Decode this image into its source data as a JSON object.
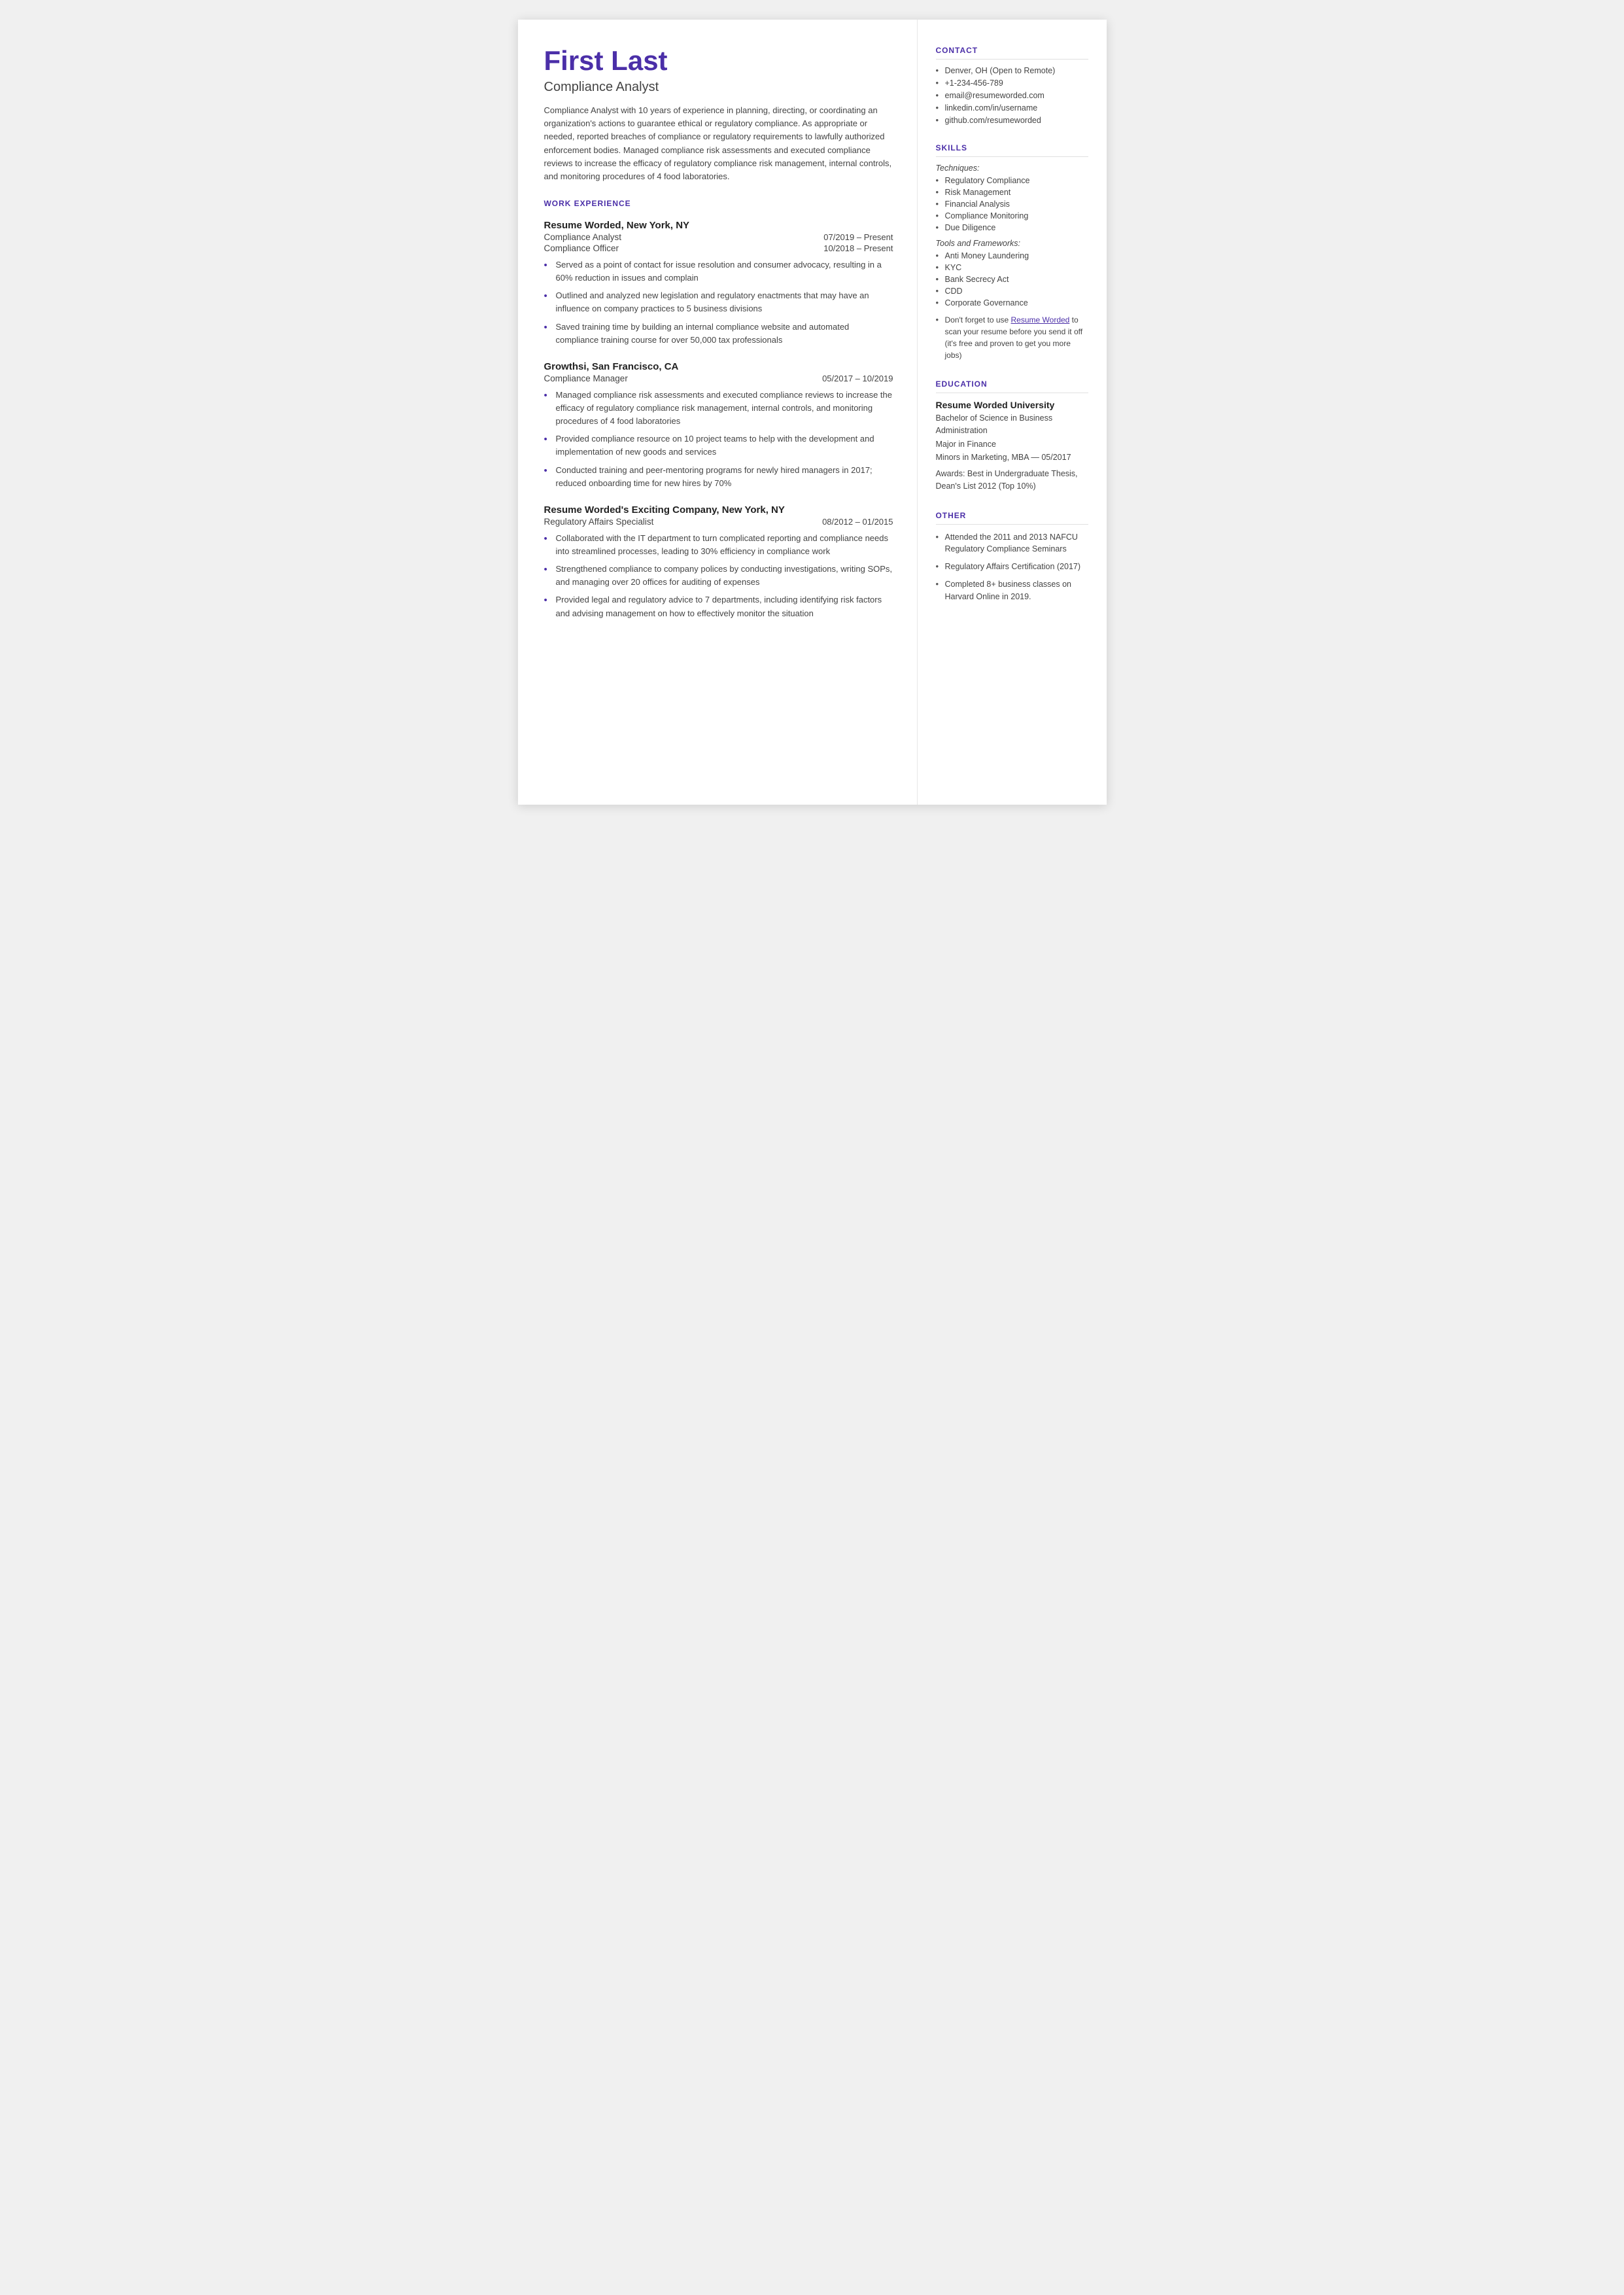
{
  "header": {
    "name": "First Last",
    "title": "Compliance Analyst",
    "summary": "Compliance Analyst with 10 years of experience in planning, directing, or coordinating an organization's actions to guarantee ethical or regulatory compliance. As appropriate or needed, reported breaches of compliance or regulatory requirements to lawfully authorized enforcement bodies. Managed compliance risk assessments and executed compliance reviews to increase the efficacy of regulatory compliance risk management, internal controls, and monitoring procedures of 4 food laboratories."
  },
  "work_experience": {
    "section_label": "WORK EXPERIENCE",
    "employers": [
      {
        "name": "Resume Worded, New York, NY",
        "roles": [
          {
            "title": "Compliance Analyst",
            "dates": "07/2019 – Present"
          },
          {
            "title": "Compliance Officer",
            "dates": "10/2018 – Present"
          }
        ],
        "bullets": [
          "Served as a point of contact for issue resolution and consumer advocacy, resulting in a 60% reduction in issues and complain",
          "Outlined and analyzed new legislation and regulatory enactments that may have an influence on company practices to 5 business divisions",
          "Saved training time by building an internal compliance website and automated compliance training course for over 50,000 tax professionals"
        ]
      },
      {
        "name": "Growthsi, San Francisco, CA",
        "roles": [
          {
            "title": "Compliance Manager",
            "dates": "05/2017 – 10/2019"
          }
        ],
        "bullets": [
          "Managed compliance risk assessments and executed compliance reviews to increase the efficacy of regulatory compliance risk management, internal controls, and monitoring procedures of 4 food laboratories",
          "Provided compliance resource on 10 project teams to help with the development and implementation of new goods and services",
          "Conducted training and peer-mentoring programs for newly hired managers in 2017; reduced onboarding time for new hires by 70%"
        ]
      },
      {
        "name": "Resume Worded's Exciting Company, New York, NY",
        "roles": [
          {
            "title": "Regulatory Affairs Specialist",
            "dates": "08/2012 – 01/2015"
          }
        ],
        "bullets": [
          "Collaborated with the IT department to turn complicated reporting and compliance needs into streamlined processes, leading to 30% efficiency in compliance work",
          "Strengthened compliance to company polices by conducting investigations, writing SOPs, and managing over 20 offices for auditing of expenses",
          "Provided legal and regulatory advice to 7 departments, including identifying risk factors and advising management on how to effectively monitor the situation"
        ]
      }
    ]
  },
  "contact": {
    "section_label": "CONTACT",
    "items": [
      "Denver, OH (Open to Remote)",
      "+1-234-456-789",
      "email@resumeworded.com",
      "linkedin.com/in/username",
      "github.com/resumeworded"
    ]
  },
  "skills": {
    "section_label": "SKILLS",
    "techniques_label": "Techniques:",
    "techniques": [
      "Regulatory Compliance",
      "Risk Management",
      "Financial Analysis",
      "Compliance Monitoring",
      "Due Diligence"
    ],
    "tools_label": "Tools and Frameworks:",
    "tools": [
      "Anti Money Laundering",
      "KYC",
      "Bank Secrecy Act",
      "CDD",
      "Corporate Governance"
    ],
    "note_prefix": "Don't forget to use ",
    "note_link_text": "Resume Worded",
    "note_suffix": " to scan your resume before you send it off (it's free and proven to get you more jobs)"
  },
  "education": {
    "section_label": "EDUCATION",
    "institution": "Resume Worded University",
    "degree": "Bachelor of Science in Business Administration",
    "major": "Major in Finance",
    "minors": "Minors in Marketing, MBA — 05/2017",
    "awards": "Awards: Best in Undergraduate Thesis, Dean's List 2012 (Top 10%)"
  },
  "other": {
    "section_label": "OTHER",
    "items": [
      "Attended the 2011 and 2013 NAFCU Regulatory Compliance Seminars",
      "Regulatory Affairs Certification (2017)",
      "Completed 8+ business classes on Harvard Online in 2019."
    ]
  }
}
